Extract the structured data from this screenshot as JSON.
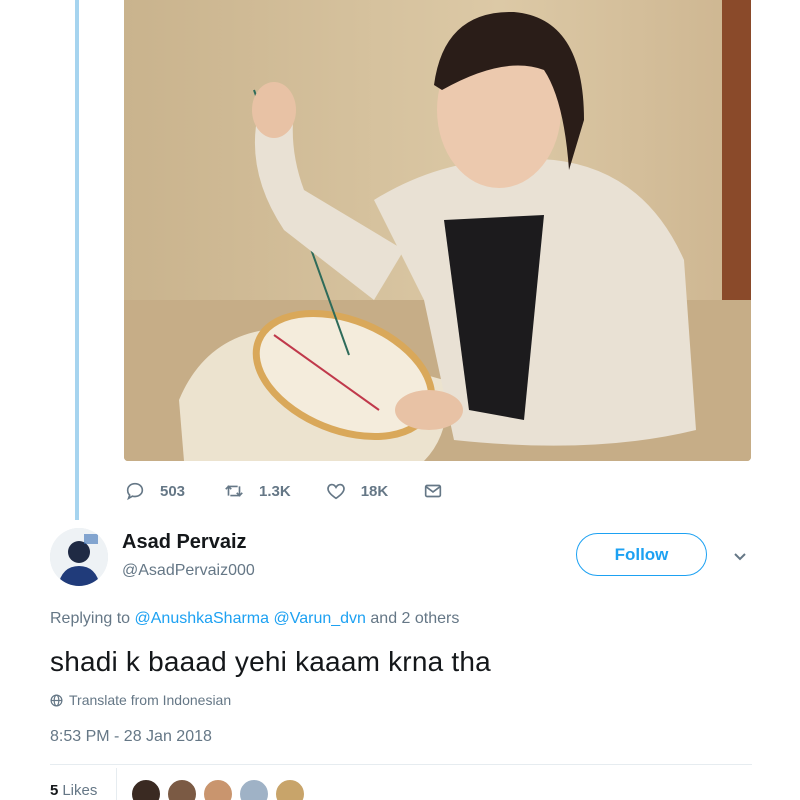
{
  "tweet_actions": {
    "replies": "503",
    "retweets": "1.3K",
    "likes": "18K"
  },
  "reply": {
    "author_name": "Asad Pervaiz",
    "author_handle": "@AsadPervaiz000",
    "follow_label": "Follow",
    "replying_prefix": "Replying to",
    "mentions": [
      "@AnushkaSharma",
      "@Varun_dvn"
    ],
    "replying_suffix": "and 2 others",
    "text": "shadi k baaad yehi kaaam krna tha",
    "translate_label": "Translate from Indonesian",
    "timestamp": "8:53 PM - 28 Jan 2018",
    "likes_count": "5",
    "likes_label": "Likes"
  },
  "colors": {
    "accent": "#1da1f2",
    "thread_line": "#a6d4ef",
    "muted": "#657786"
  },
  "icons": [
    "reply-icon",
    "retweet-icon",
    "heart-icon",
    "message-icon",
    "chevron-down-icon",
    "globe-icon"
  ]
}
